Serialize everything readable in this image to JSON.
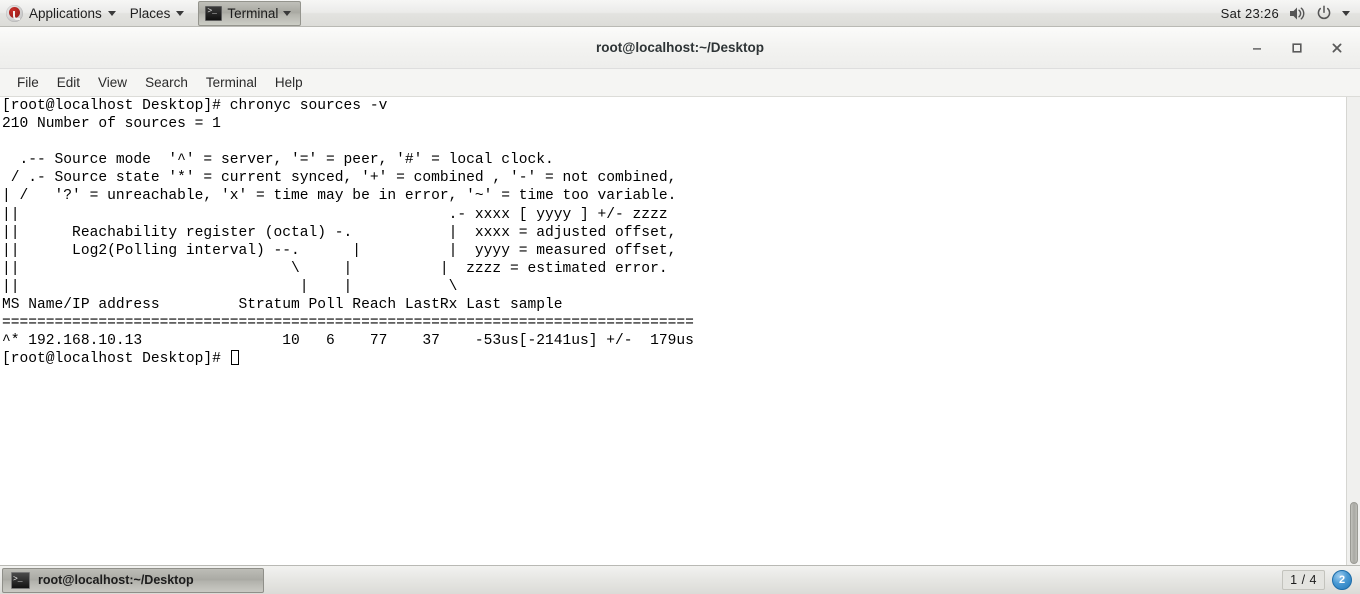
{
  "top_panel": {
    "applications_label": "Applications",
    "places_label": "Places",
    "window_list_label": "Terminal",
    "clock": "Sat 23:26",
    "icons": {
      "menu_logo": "fedora-logo-icon",
      "volume": "speaker-icon",
      "power": "power-icon",
      "dropdown": "chevron-down-icon"
    }
  },
  "window": {
    "title": "root@localhost:~/Desktop",
    "buttons": {
      "minimize": "–",
      "maximize": "□",
      "close": "✕"
    }
  },
  "menubar": {
    "items": [
      {
        "label": "File"
      },
      {
        "label": "Edit"
      },
      {
        "label": "View"
      },
      {
        "label": "Search"
      },
      {
        "label": "Terminal"
      },
      {
        "label": "Help"
      }
    ]
  },
  "terminal": {
    "lines": [
      "[root@localhost Desktop]# chronyc sources -v",
      "210 Number of sources = 1",
      "",
      "  .-- Source mode  '^' = server, '=' = peer, '#' = local clock.",
      " / .- Source state '*' = current synced, '+' = combined , '-' = not combined,",
      "| /   '?' = unreachable, 'x' = time may be in error, '~' = time too variable.",
      "||                                                 .- xxxx [ yyyy ] +/- zzzz",
      "||      Reachability register (octal) -.           |  xxxx = adjusted offset,",
      "||      Log2(Polling interval) --.      |          |  yyyy = measured offset,",
      "||                               \\     |          |  zzzz = estimated error.",
      "||                                |    |           \\",
      "MS Name/IP address         Stratum Poll Reach LastRx Last sample",
      "===============================================================================",
      "^* 192.168.10.13                10   6    77    37    -53us[-2141us] +/-  179us"
    ],
    "prompt": "[root@localhost Desktop]# ",
    "command": "chronyc sources -v",
    "status_line": "210 Number of sources = 1",
    "columns": [
      "MS",
      "Name/IP address",
      "Stratum",
      "Poll",
      "Reach",
      "LastRx",
      "Last sample"
    ],
    "rows": [
      {
        "ms": "^*",
        "name_ip": "192.168.10.13",
        "stratum": "10",
        "poll": "6",
        "reach": "77",
        "lastrx": "37",
        "last_sample": "-53us[-2141us] +/-  179us"
      }
    ]
  },
  "bottom_panel": {
    "task_label": "root@localhost:~/Desktop",
    "workspace": "1 / 4",
    "notification_count": "2"
  }
}
